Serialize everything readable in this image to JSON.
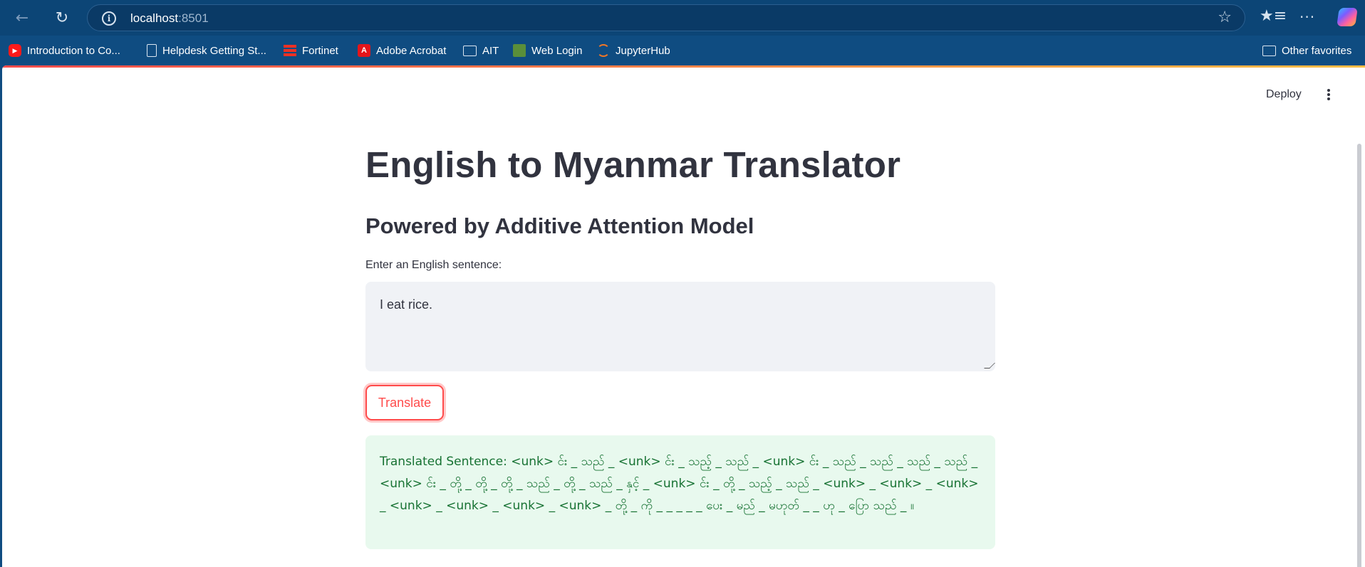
{
  "browser": {
    "url_host": "localhost",
    "url_port": ":8501",
    "bookmarks": [
      {
        "label": "Introduction to Co...",
        "icon": "youtube-icon"
      },
      {
        "label": "Helpdesk Getting St...",
        "icon": "document-icon"
      },
      {
        "label": "Fortinet",
        "icon": "fortinet-icon"
      },
      {
        "label": "Adobe Acrobat",
        "icon": "acrobat-icon"
      },
      {
        "label": "AIT",
        "icon": "folder-icon"
      },
      {
        "label": "Web Login",
        "icon": "web-login-icon"
      },
      {
        "label": "JupyterHub",
        "icon": "jupyter-icon"
      }
    ],
    "other_favorites": "Other favorites"
  },
  "app": {
    "deploy_label": "Deploy",
    "title": "English to Myanmar Translator",
    "subtitle": "Powered by Additive Attention Model",
    "input_label": "Enter an English sentence:",
    "input_value": "I eat rice.",
    "button_label": "Translate",
    "result_text": "Translated Sentence: <unk> င်း _ သည် _ <unk> င်း _ သည့် _ သည် _ <unk> င်း _ သည် _ သည် _ သည် _ သည် _ <unk> င်း _ တို့ _ တို့ _ တို့ _ သည် _ တို့ _ သည် _ နှင့် _ <unk> င်း _ တို့ _ သည့် _ သည် _ <unk> _ <unk> _ <unk> _ <unk> _ <unk> _ <unk> _ <unk> _ တို့ _ ကို _ _ _ _ _ ပေး _ မည် _ မဟုတ် _ _ ဟု _ ပြော သည် _ ။"
  },
  "colors": {
    "accent": "#ff4b4b",
    "success_bg": "#e8f9ee",
    "success_text": "#177233",
    "browser_bg": "#0f4c81"
  }
}
